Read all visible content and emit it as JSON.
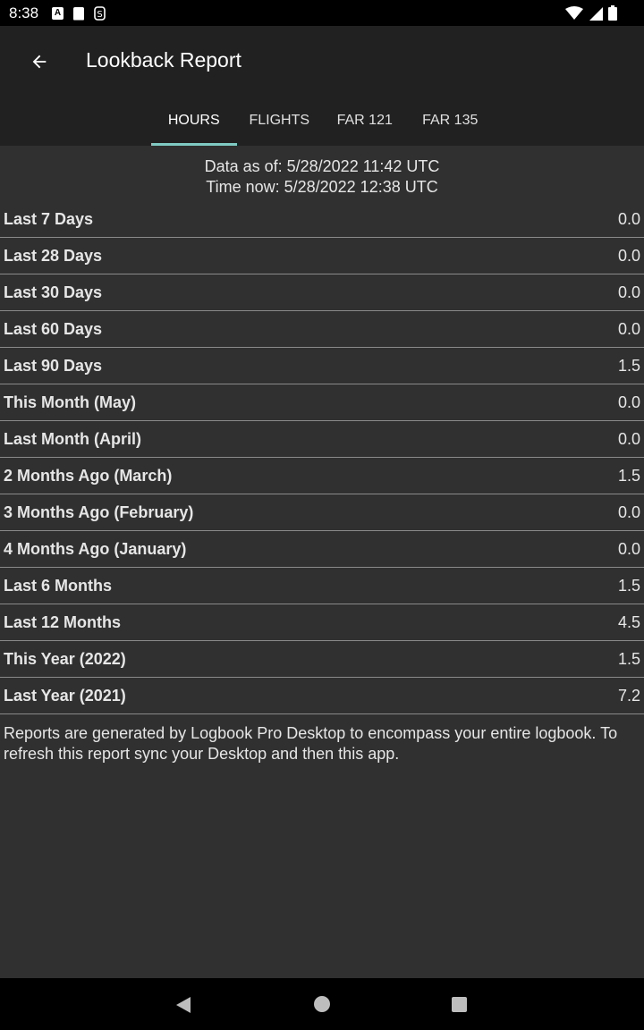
{
  "status_bar": {
    "time": "8:38",
    "left_icons": [
      "a-icon",
      "sd-card-icon",
      "s-icon"
    ],
    "right_icons": [
      "wifi-icon",
      "signal-icon",
      "battery-icon"
    ]
  },
  "app_bar": {
    "title": "Lookback Report",
    "back_icon": "arrow-back-icon"
  },
  "tabs": [
    {
      "label": "HOURS",
      "active": true
    },
    {
      "label": "FLIGHTS",
      "active": false
    },
    {
      "label": "FAR 121",
      "active": false
    },
    {
      "label": "FAR 135",
      "active": false
    }
  ],
  "report": {
    "data_as_of": "Data as of: 5/28/2022 11:42 UTC",
    "time_now": "Time now: 5/28/2022 12:38 UTC",
    "rows": [
      {
        "label": "Last 7 Days",
        "value": "0.0"
      },
      {
        "label": "Last 28 Days",
        "value": "0.0"
      },
      {
        "label": "Last 30 Days",
        "value": "0.0"
      },
      {
        "label": "Last 60 Days",
        "value": "0.0"
      },
      {
        "label": "Last 90 Days",
        "value": "1.5"
      },
      {
        "label": "This Month (May)",
        "value": "0.0"
      },
      {
        "label": "Last Month (April)",
        "value": "0.0"
      },
      {
        "label": "2 Months Ago (March)",
        "value": "1.5"
      },
      {
        "label": "3 Months Ago (February)",
        "value": "0.0"
      },
      {
        "label": "4 Months Ago (January)",
        "value": "0.0"
      },
      {
        "label": "Last 6 Months",
        "value": "1.5"
      },
      {
        "label": "Last 12 Months",
        "value": "4.5"
      },
      {
        "label": "This Year (2022)",
        "value": "1.5"
      },
      {
        "label": "Last Year (2021)",
        "value": "7.2"
      }
    ],
    "footer_note": "Reports are generated by Logbook Pro Desktop to encompass your entire logbook. To refresh this report sync your Desktop and then this app."
  },
  "colors": {
    "app_bar_bg": "#212121",
    "content_bg": "#303030",
    "tab_indicator": "#80cbc4"
  }
}
